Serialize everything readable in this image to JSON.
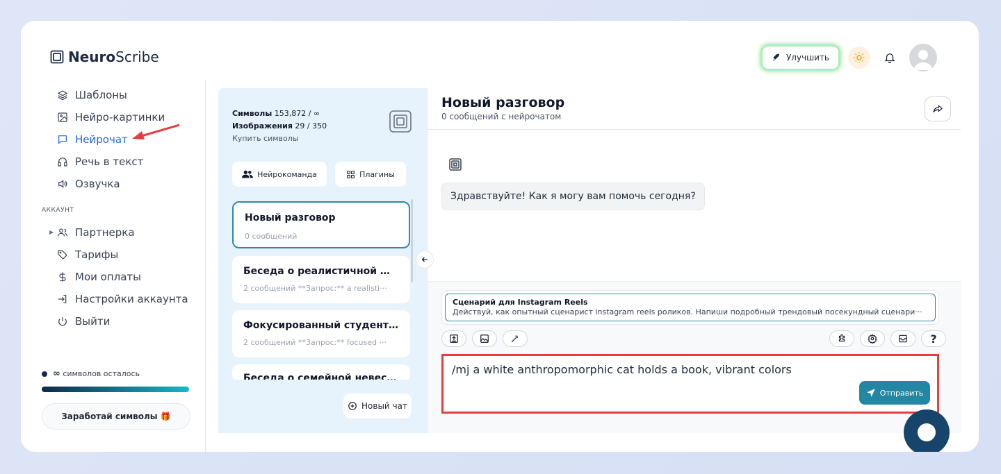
{
  "brand": {
    "name_bold": "Neuro",
    "name_rest": "Scribe"
  },
  "header": {
    "upgrade_label": "Улучшить"
  },
  "sidebar": {
    "items": [
      {
        "label": "Шаблоны",
        "icon": "layers-icon"
      },
      {
        "label": "Нейро-картинки",
        "icon": "image-icon"
      },
      {
        "label": "Нейрочат",
        "icon": "chat-icon",
        "active": true
      },
      {
        "label": "Речь в текст",
        "icon": "headphones-icon"
      },
      {
        "label": "Озвучка",
        "icon": "speaker-icon"
      }
    ],
    "account_label": "АККАУНТ",
    "account_items": [
      {
        "label": "Партнерка",
        "icon": "users-icon"
      },
      {
        "label": "Тарифы",
        "icon": "tag-icon"
      },
      {
        "label": "Мои оплаты",
        "icon": "dollar-icon"
      },
      {
        "label": "Настройки аккаунта",
        "icon": "login-icon"
      },
      {
        "label": "Выйти",
        "icon": "power-icon"
      }
    ],
    "symbols_left_prefix": "∞",
    "symbols_left_text": "символов осталось",
    "earn_label": "Заработай символы 🎁"
  },
  "stats": {
    "symbols_label": "Символы",
    "symbols_value": "153,872 / ∞",
    "images_label": "Изображения",
    "images_value": "29 / 350",
    "buy_label": "Купить символы"
  },
  "chatlist": {
    "team_label": "Нейрокоманда",
    "plugins_label": "Плагины",
    "conversations": [
      {
        "title": "Новый разговор",
        "sub": "0 сообщений"
      },
      {
        "title": "Беседа о реалистичной фо···",
        "sub": "2 сообщений   **Запрос:** a realisti···"
      },
      {
        "title": "Фокусированный студент ···",
        "sub": "2 сообщений   **Запрос:** focused ···"
      },
      {
        "title": "Беседа о семейной невесте",
        "sub": ""
      }
    ],
    "new_chat_label": "Новый чат"
  },
  "chat": {
    "title": "Новый разговор",
    "subtitle": "0 сообщений с нейрочатом",
    "greeting": "Здравствуйте! Как я могу вам помочь сегодня?",
    "prompt_title": "Сценарий для Instagram Reels",
    "prompt_text": "Действуй, как опытный сценарист instagram reels роликов. Напиши подробный трендовый посекундный сценари···",
    "input_value": "/mj a white anthropomorphic cat holds a book, vibrant colors",
    "send_label": "Отправить"
  },
  "colors": {
    "accent": "#2386a3",
    "highlight": "#e53e3e",
    "active_nav": "#2563eb"
  }
}
